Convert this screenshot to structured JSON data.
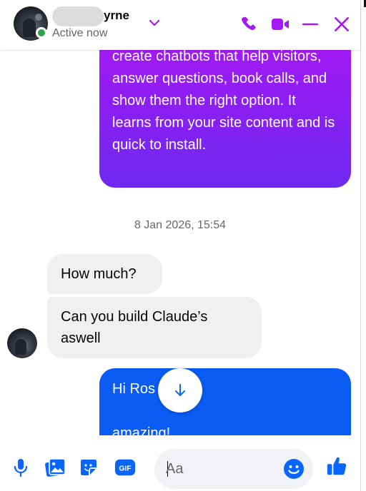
{
  "header": {
    "name_suffix": "yrne",
    "status": "Active now"
  },
  "messages": {
    "outgoing_top": "create chatbots that help visitors, answer questions, book calls, and show them the right option. It learns from your site content and is quick to install.",
    "timestamp": "8 Jan 2026, 15:54",
    "incoming_1": "How much?",
    "incoming_2": "Can you build Claude’s aswell",
    "outgoing_blue_line1": "Hi Ros",
    "outgoing_blue_line2": "amazing!"
  },
  "composer": {
    "placeholder": "Aa"
  },
  "colors": {
    "accent": "#a419f5",
    "outgoing_blue": "#0a5cf5",
    "online": "#31a24c",
    "composer_icon": "#0866ff"
  }
}
